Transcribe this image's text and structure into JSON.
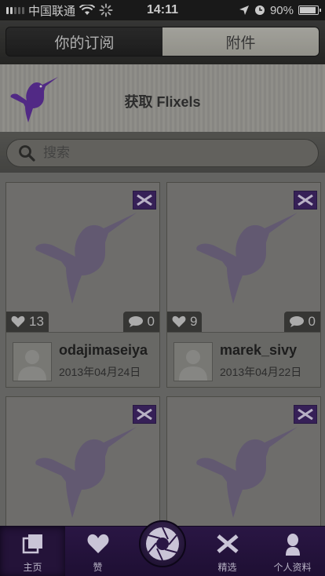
{
  "status_bar": {
    "carrier": "中国联通",
    "time": "14:11",
    "battery": "90%",
    "battery_level": 0.9
  },
  "segments": {
    "subscriptions_label": "你的订阅",
    "attachments_label": "附件",
    "active": "subscriptions"
  },
  "promo": {
    "text": "获取 Flixels",
    "icon": "hummingbird-logo"
  },
  "search": {
    "placeholder": "搜索"
  },
  "cards": [
    {
      "likes": "13",
      "comments": "0",
      "user": "odajimaseiya",
      "date": "2013年04月24日"
    },
    {
      "likes": "9",
      "comments": "0",
      "user": "marek_sivy",
      "date": "2013年04月22日"
    },
    {
      "likes": "",
      "comments": "",
      "user": "",
      "date": ""
    },
    {
      "likes": "",
      "comments": "",
      "user": "",
      "date": ""
    }
  ],
  "tabbar": {
    "home_label": "主页",
    "like_label": "赞",
    "featured_label": "精选",
    "profile_label": "个人资料"
  },
  "colors": {
    "accent_purple": "#3a1f62",
    "tabbar_bg": "#2a1644",
    "bird_purple": "#5b2a9a"
  }
}
